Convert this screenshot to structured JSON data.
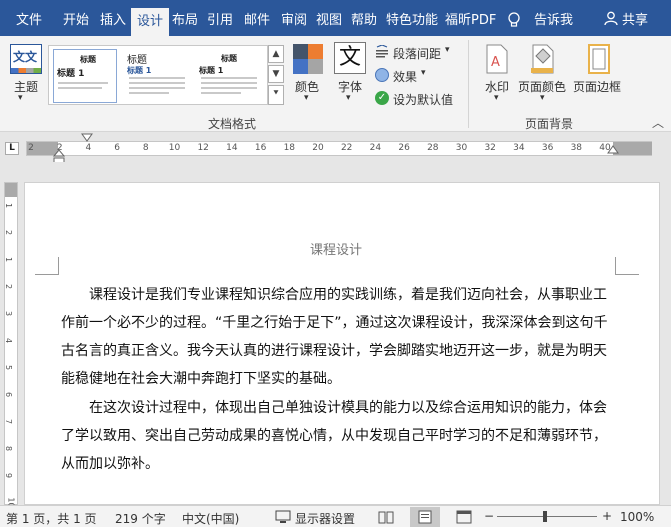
{
  "menu": {
    "tabs": [
      "文件",
      "开始",
      "插入",
      "设计",
      "布局",
      "引用",
      "邮件",
      "审阅",
      "视图",
      "帮助",
      "特色功能",
      "福昕PDF"
    ],
    "active_tab": "设计",
    "tell_me": "告诉我",
    "share": "共享"
  },
  "ribbon": {
    "theme_label": "主题",
    "theme_icon_text": "文文",
    "gallery": [
      {
        "title": "标题",
        "heading": "标题 1"
      },
      {
        "title": "标题",
        "heading": "标题 1"
      },
      {
        "title": "标题",
        "heading": "标题 1"
      }
    ],
    "colors_label": "颜色",
    "fonts_label": "字体",
    "fonts_icon_text": "文",
    "paragraph_spacing_label": "段落间距",
    "effects_label": "效果",
    "set_default_label": "设为默认值",
    "doc_format_group": "文档格式",
    "watermark_label": "水印",
    "page_color_label": "页面颜色",
    "page_border_label": "页面边框",
    "page_background_group": "页面背景",
    "collapse_icon": "chevron-up-icon"
  },
  "ruler": {
    "ticks": [
      "2",
      "2",
      "4",
      "6",
      "8",
      "10",
      "12",
      "14",
      "16",
      "18",
      "20",
      "22",
      "24",
      "26",
      "28",
      "30",
      "32",
      "34",
      "36",
      "38",
      "40"
    ],
    "vticks": [
      "1",
      "2",
      "1",
      "2",
      "3",
      "4",
      "5",
      "6",
      "7",
      "8",
      "9",
      "10"
    ],
    "tab_selector": "L"
  },
  "document": {
    "header": "课程设计",
    "lines": [
      "课程设计是我们专业课程知识综合应用的实践训练，着是我们迈向社会，从事职业工",
      "作前一个必不少的过程。“千里之行始于足下”，通过这次课程设计，我深深体会到这句千",
      "古名言的真正含义。我今天认真的进行课程设计，学会脚踏实地迈开这一步，就是为明天",
      "能稳健地在社会大潮中奔跑打下坚实的基础。",
      "在这次设计过程中，体现出自己单独设计模具的能力以及综合运用知识的能力，体会",
      "了学以致用、突出自己劳动成果的喜悦心情，从中发现自己平时学习的不足和薄弱环节，",
      "从而加以弥补。"
    ]
  },
  "status": {
    "page": "第 1 页，共 1 页",
    "words": "219 个字",
    "language": "中文(中国)",
    "display_settings": "显示器设置",
    "zoom": "100%",
    "zoom_minus": "−",
    "zoom_plus": "+"
  },
  "colors": {
    "brand": "#2b579a",
    "ribbon_bg": "#f3f3f3",
    "canvas_bg": "#e6e6e6"
  }
}
